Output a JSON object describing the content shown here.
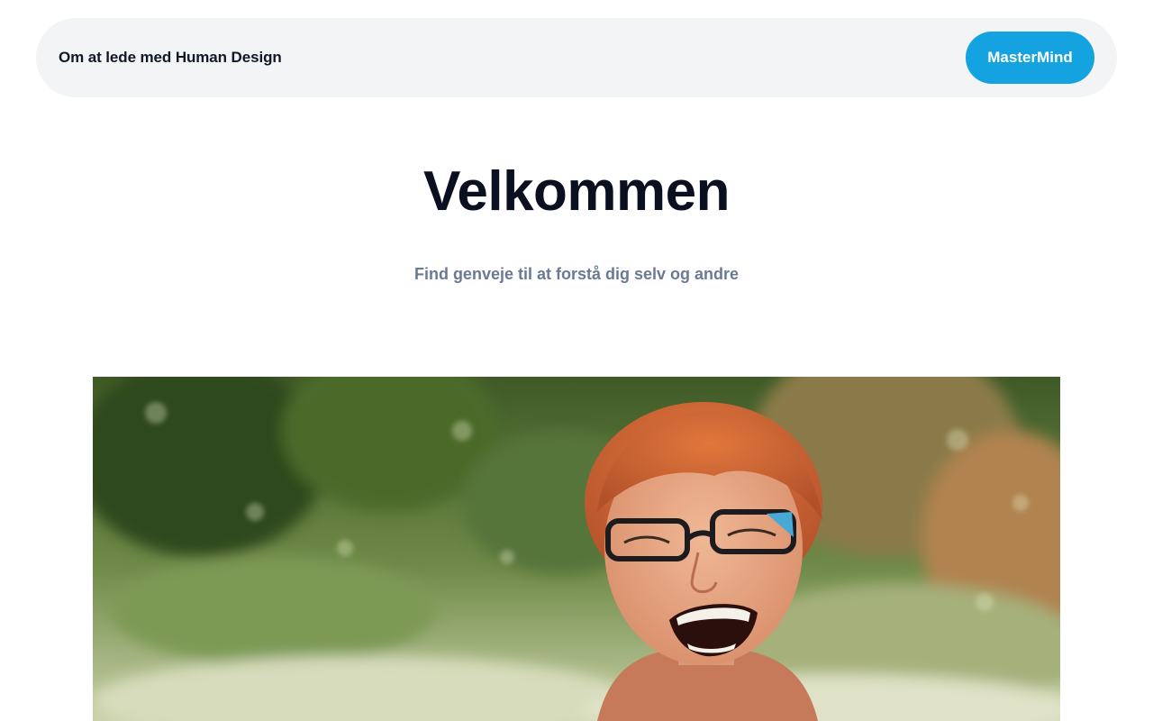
{
  "header": {
    "site_title": "Om at lede med Human Design",
    "cta_label": "MasterMind"
  },
  "hero": {
    "heading": "Velkommen",
    "subtitle": "Find genveje til at forstå dig selv og andre"
  },
  "photo": {
    "subject": "smiling-woman-photo"
  },
  "colors": {
    "accent": "#14a3e0",
    "nav_background": "#f2f4f6",
    "heading": "#0b1020",
    "subtitle": "#6b7a93"
  }
}
